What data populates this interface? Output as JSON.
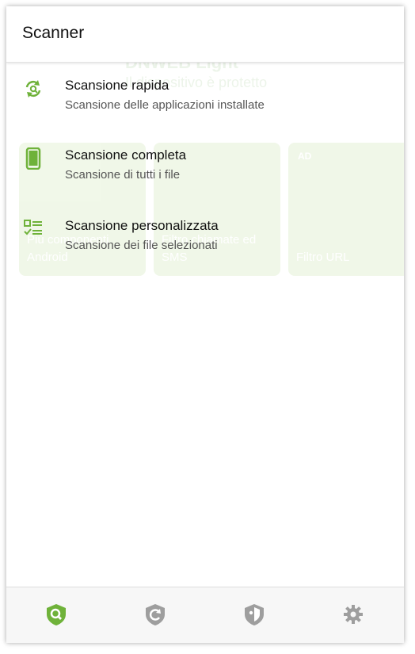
{
  "header": {
    "title": "Scanner"
  },
  "background": {
    "brand": "DNWEB",
    "brand_suffix": "Light",
    "status": "Il dispositivo è protetto",
    "cards": [
      {
        "label": "Più componenti Android",
        "ad": ""
      },
      {
        "label": "Filtro chiamate ed SMS",
        "ad": ""
      },
      {
        "label": "Filtro URL",
        "ad": "AD"
      }
    ]
  },
  "menu": {
    "items": [
      {
        "icon": "refresh-search-icon",
        "label": "Scansione rapida",
        "desc": "Scansione delle applicazioni installate"
      },
      {
        "icon": "smartphone-icon",
        "label": "Scansione completa",
        "desc": "Scansione di tutti i file"
      },
      {
        "icon": "checklist-icon",
        "label": "Scansione personalizzata",
        "desc": "Scansione dei file selezionati"
      }
    ]
  },
  "bottom_nav": [
    {
      "icon": "scanner-search-shield-icon",
      "active": true
    },
    {
      "icon": "update-shield-icon",
      "active": false
    },
    {
      "icon": "security-shield-icon",
      "active": false
    },
    {
      "icon": "settings-gear-icon",
      "active": false
    }
  ],
  "colors": {
    "accent": "#6fb23a",
    "inactive_icon": "#9e9e9e"
  }
}
